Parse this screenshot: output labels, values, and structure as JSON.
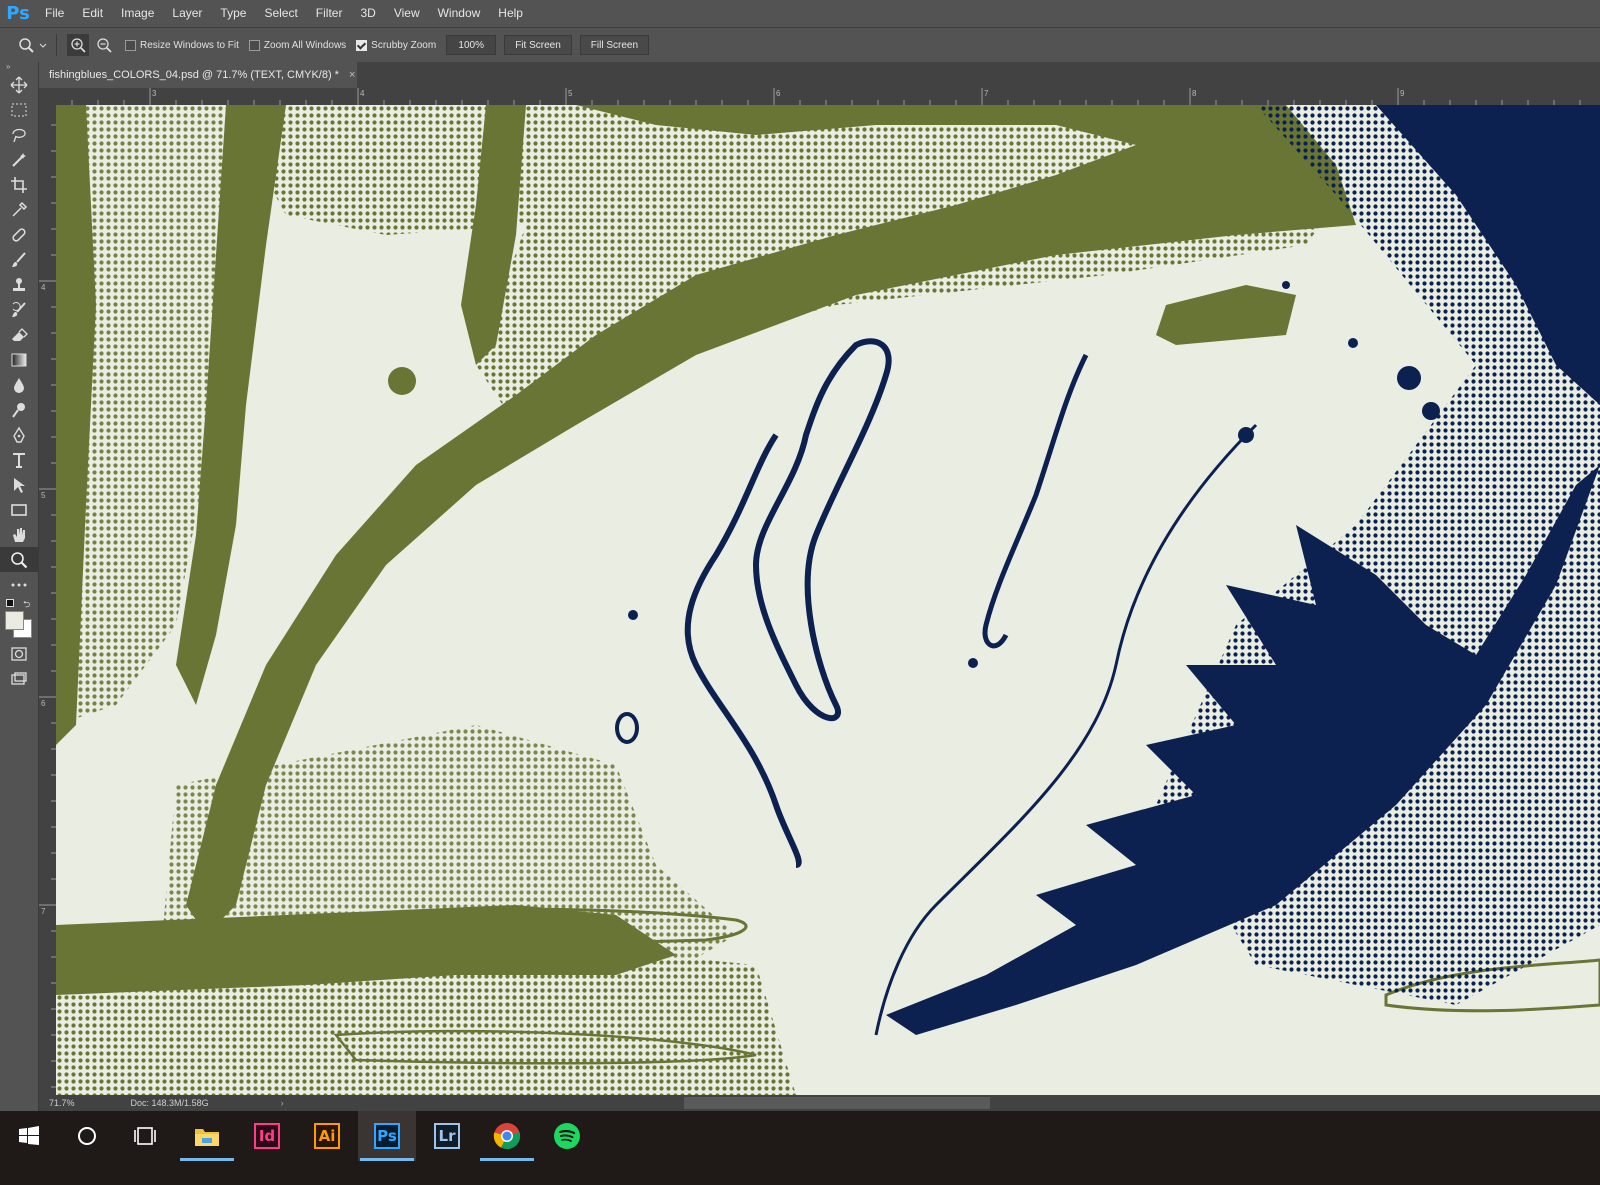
{
  "app": {
    "logo": "Ps"
  },
  "menu": [
    "File",
    "Edit",
    "Image",
    "Layer",
    "Type",
    "Select",
    "Filter",
    "3D",
    "View",
    "Window",
    "Help"
  ],
  "options": {
    "resize_windows": {
      "label": "Resize Windows to Fit",
      "checked": false
    },
    "zoom_all": {
      "label": "Zoom All Windows",
      "checked": false
    },
    "scrubby": {
      "label": "Scrubby Zoom",
      "checked": true
    },
    "zoom_value": "100%",
    "fit_screen": "Fit Screen",
    "fill_screen": "Fill Screen"
  },
  "document": {
    "tab_title": "fishingblues_COLORS_04.psd @ 71.7% (TEXT, CMYK/8) *",
    "close": "×"
  },
  "ruler": {
    "h": [
      "3",
      "4",
      "5",
      "6",
      "7",
      "8",
      "9"
    ],
    "v": [
      "4",
      "5",
      "6",
      "7"
    ]
  },
  "status": {
    "zoom": "71.7%",
    "doc": "Doc: 148.3M/1.58G"
  },
  "colors": {
    "olive": "#687535",
    "navy": "#0c2150",
    "paper": "#e9ede2",
    "ui": "#535353"
  },
  "taskbar": {
    "apps": [
      {
        "name": "explorer",
        "label": ""
      },
      {
        "name": "indesign",
        "label": "Id"
      },
      {
        "name": "illustrator",
        "label": "Ai"
      },
      {
        "name": "photoshop",
        "label": "Ps"
      },
      {
        "name": "lightroom",
        "label": "Lr"
      },
      {
        "name": "chrome",
        "label": ""
      },
      {
        "name": "spotify",
        "label": ""
      }
    ]
  }
}
